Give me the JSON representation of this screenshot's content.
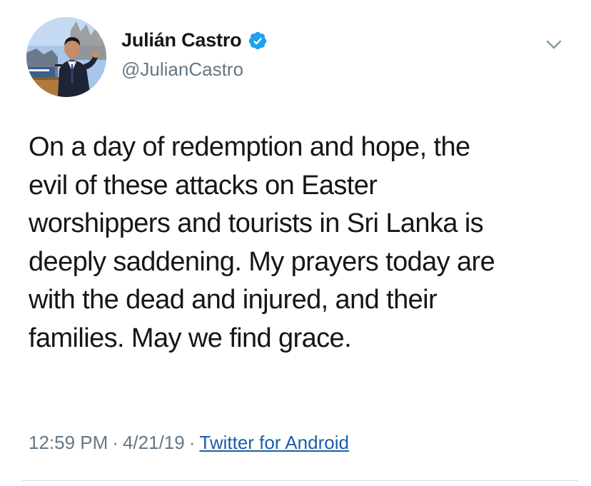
{
  "tweet": {
    "author": {
      "display_name": "Julián Castro",
      "handle": "@JulianCastro",
      "verified": true,
      "avatar_icon": "profile-photo-avatar"
    },
    "menu_icon": "chevron-down-icon",
    "text": "On a day of redemption and hope, the\nevil of these attacks on Easter\nworshippers and tourists in Sri Lanka is\ndeeply saddening. My prayers today are\nwith the dead and injured, and their\nfamilies. May we find grace.",
    "time": "12:59 PM",
    "separator": "·",
    "date": "4/21/19",
    "source": "Twitter for Android"
  },
  "colors": {
    "text_primary": "#14171a",
    "text_secondary": "#657786",
    "verified_blue": "#1da1f2",
    "link": "#1b5fa8",
    "divider": "#d6dbe0"
  }
}
